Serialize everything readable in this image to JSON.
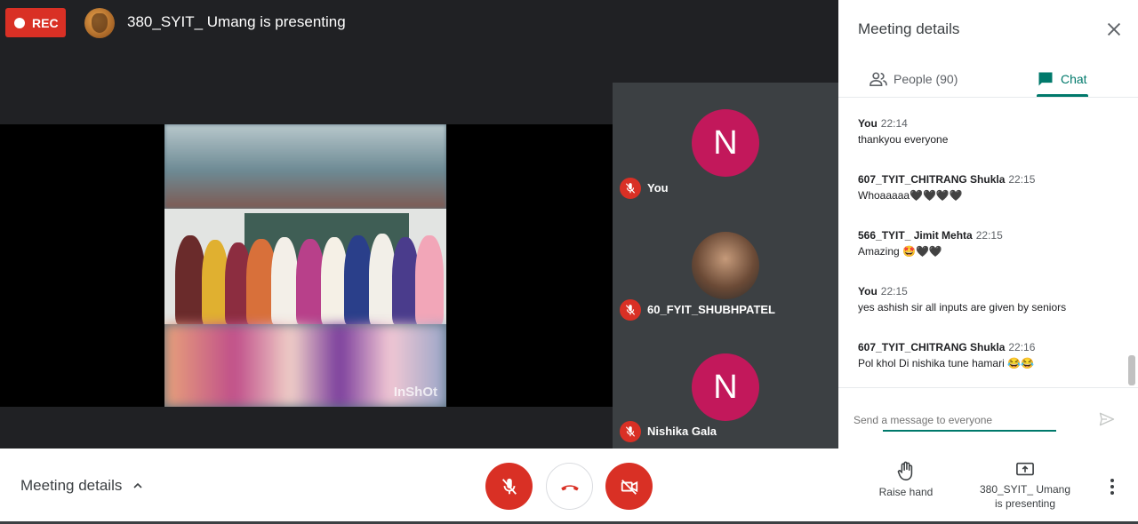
{
  "recording": {
    "label": "REC"
  },
  "presentation": {
    "title": "380_SYIT_ Umang is presenting",
    "watermark": "InShOt"
  },
  "participants": [
    {
      "name": "You",
      "avatar_letter": "N",
      "muted": true
    },
    {
      "name": "60_FYIT_SHUBHPATEL",
      "avatar_letter": "",
      "muted": true
    },
    {
      "name": "Nishika Gala",
      "avatar_letter": "N",
      "muted": true
    }
  ],
  "panel": {
    "title": "Meeting details",
    "tabs": [
      {
        "label": "People (90)",
        "active": false
      },
      {
        "label": "Chat",
        "active": true
      }
    ],
    "messages": [
      {
        "sender": "You",
        "time": "22:14",
        "text": "thankyou everyone"
      },
      {
        "sender": "607_TYIT_CHITRANG Shukla",
        "time": "22:15",
        "text": "Whoaaaaa🖤🖤🖤🖤"
      },
      {
        "sender": "566_TYIT_ Jimit Mehta",
        "time": "22:15",
        "text": "Amazing 🤩🖤🖤"
      },
      {
        "sender": "You",
        "time": "22:15",
        "text": "yes ashish sir all inputs are given by seniors"
      },
      {
        "sender": "607_TYIT_CHITRANG Shukla",
        "time": "22:16",
        "text": "Pol khol Di nishika tune hamari 😂😂"
      }
    ],
    "composer_placeholder": "Send a message to everyone"
  },
  "bottom_bar": {
    "meeting_details_label": "Meeting details",
    "raise_hand_label": "Raise hand",
    "presenting_line1": "380_SYIT_ Umang",
    "presenting_line2": "is presenting"
  },
  "colors": {
    "accent_red": "#d93025",
    "accent_teal": "#00796b",
    "avatar_pink": "#c2185b",
    "stage_dark": "#202124",
    "tile_gray": "#3c4043"
  },
  "icons": [
    "mic-off-icon",
    "hangup-icon",
    "camera-off-icon",
    "raise-hand-icon",
    "present-icon",
    "more-icon",
    "close-icon",
    "people-icon",
    "chat-icon",
    "send-icon",
    "chevron-up-icon"
  ]
}
